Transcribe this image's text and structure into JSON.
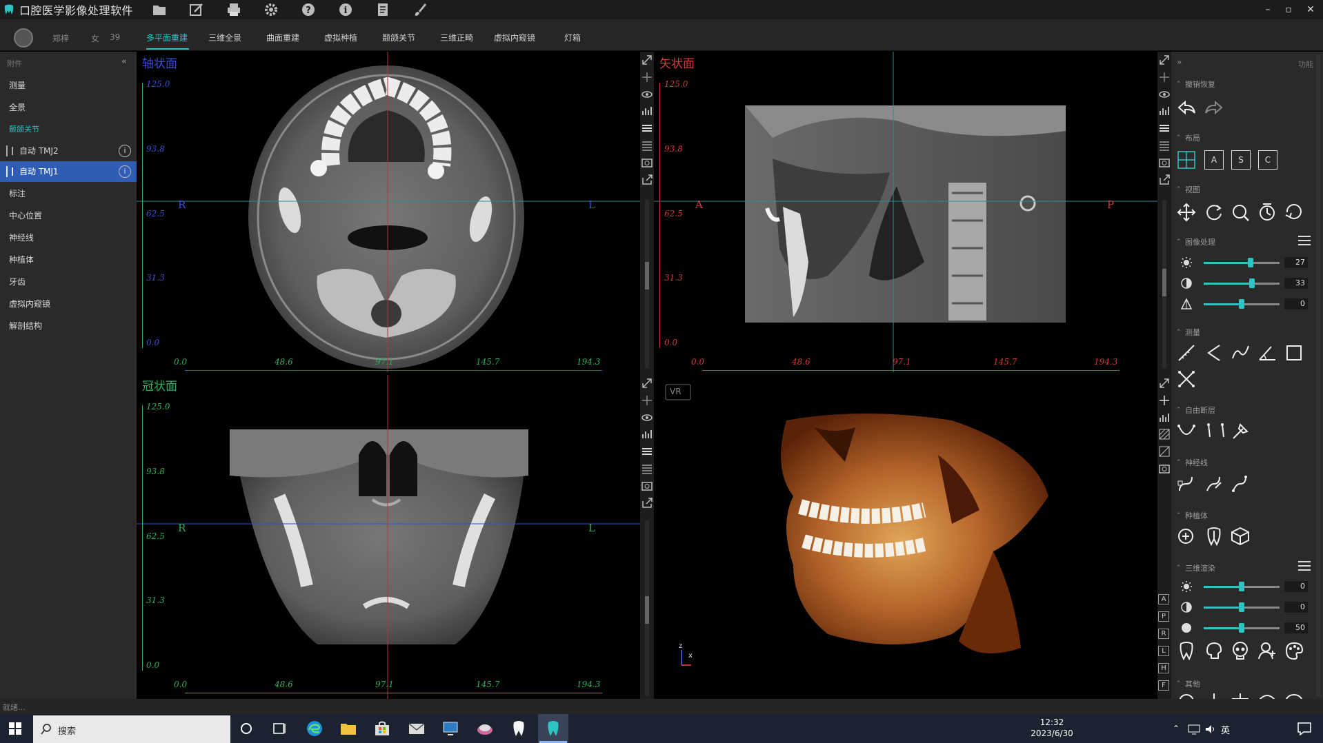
{
  "app": {
    "title": "口腔医学影像处理软件",
    "window_controls": [
      "–",
      "▫",
      "✕"
    ]
  },
  "patient": {
    "name": "郑梓",
    "sex": "女",
    "age": "39"
  },
  "tabs": [
    {
      "label": "多平面重建",
      "active": true
    },
    {
      "label": "三维全景"
    },
    {
      "label": "曲面重建"
    },
    {
      "label": "虚拟种植"
    },
    {
      "label": "颞颌关节"
    },
    {
      "label": "三维正畸"
    },
    {
      "label": "虚拟内窥镜"
    },
    {
      "label": "灯箱"
    }
  ],
  "sidebar": {
    "header": "附件",
    "collapse": "«",
    "items": [
      {
        "label": "测量"
      },
      {
        "label": "全景"
      },
      {
        "label": "颞颌关节",
        "color": "#2ec4c4"
      },
      {
        "label": "自动 TMJ2",
        "sub": true
      },
      {
        "label": "自动 TMJ1",
        "sub": true,
        "selected": true
      },
      {
        "label": "标注"
      },
      {
        "label": "中心位置"
      },
      {
        "label": "神经线"
      },
      {
        "label": "种植体"
      },
      {
        "label": "牙齿"
      },
      {
        "label": "虚拟内窥镜"
      },
      {
        "label": "解剖结构"
      }
    ],
    "info_symbol": "i"
  },
  "viewports": {
    "axial": {
      "title": "轴状面",
      "left_mark": "R",
      "right_mark": "L",
      "y_ticks": [
        "125.0",
        "93.8",
        "62.5",
        "31.3",
        "0.0"
      ],
      "x_ticks": [
        "0.0",
        "48.6",
        "97.1",
        "145.7",
        "194.3"
      ]
    },
    "sagittal": {
      "title": "矢状面",
      "left_mark": "A",
      "right_mark": "P",
      "y_ticks": [
        "125.0",
        "93.8",
        "62.5",
        "31.3",
        "0.0"
      ],
      "x_ticks": [
        "0.0",
        "48.6",
        "97.1",
        "145.7",
        "194.3"
      ]
    },
    "coronal": {
      "title": "冠状面",
      "left_mark": "R",
      "right_mark": "L",
      "y_ticks": [
        "125.0",
        "93.8",
        "62.5",
        "31.3",
        "0.0"
      ],
      "x_ticks": [
        "0.0",
        "48.6",
        "97.1",
        "145.7",
        "194.3"
      ]
    },
    "volume": {
      "badge": "VR",
      "axes": [
        "z",
        "x"
      ]
    },
    "side_letters": [
      "A",
      "P",
      "R",
      "L",
      "H",
      "F"
    ]
  },
  "right_panel": {
    "expand": "»",
    "header": "功能",
    "sections": {
      "undo": "撤销恢复",
      "layout": "布局",
      "layout_buttons": [
        "A",
        "S",
        "C"
      ],
      "view": "视图",
      "image_proc": "图像处理",
      "measure": "测量",
      "free_slice": "自由断层",
      "nerve": "神经线",
      "implant": "种植体",
      "render3d": "三维渲染",
      "other": "其他"
    },
    "image_sliders": [
      {
        "icon": "brightness-icon",
        "value": "27",
        "level": 0.62
      },
      {
        "icon": "contrast-icon",
        "value": "33",
        "level": 0.64
      },
      {
        "icon": "sharpen-icon",
        "value": "0",
        "level": 0.5
      }
    ],
    "render_sliders": [
      {
        "icon": "brightness-icon",
        "value": "0",
        "level": 0.5
      },
      {
        "icon": "contrast-icon",
        "value": "0",
        "level": 0.5
      },
      {
        "icon": "opacity-icon",
        "value": "50",
        "level": 0.5
      }
    ]
  },
  "status": {
    "text": "就绪..."
  },
  "taskbar": {
    "search_placeholder": "搜索",
    "time": "12:32",
    "date": "2023/6/30",
    "ime": "英"
  },
  "colors": {
    "accent": "#2ec4c4",
    "selected": "#2f5db6",
    "axial_label": "#3a4fd0",
    "sagittal_label": "#d03a3a",
    "coronal_label": "#2fb05a"
  }
}
